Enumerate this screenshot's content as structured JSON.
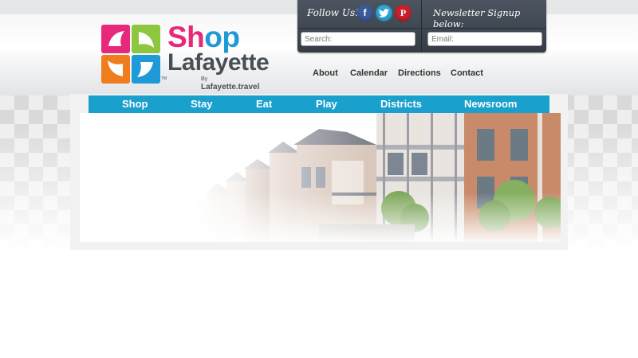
{
  "brand": {
    "word1_part1": "Sh",
    "word1_part2": "op",
    "word2": "Lafayette",
    "by_prefix": "By",
    "by_site": "Lafayette.travel",
    "tm": "TM",
    "colors": {
      "pink": "#e8287a",
      "orange": "#f07d1d",
      "green": "#8dc63f",
      "blue": "#1e9ad6",
      "gray": "#4a4f56"
    }
  },
  "top_panel": {
    "follow_label": "Follow Us!",
    "social": [
      {
        "name": "facebook",
        "glyph": "f"
      },
      {
        "name": "twitter",
        "glyph": "t"
      },
      {
        "name": "pinterest",
        "glyph": "P"
      }
    ],
    "newsletter_label": "Newsletter Signup below:",
    "search_placeholder": "Search:",
    "email_placeholder": "Email:"
  },
  "subnav": [
    "About",
    "Calendar",
    "Directions",
    "Contact"
  ],
  "mainnav": [
    "Shop",
    "Stay",
    "Eat",
    "Play",
    "Districts",
    "Newsroom"
  ],
  "colors": {
    "nav_blue": "#1aa0cc",
    "panel_dark": "#3a424c"
  }
}
